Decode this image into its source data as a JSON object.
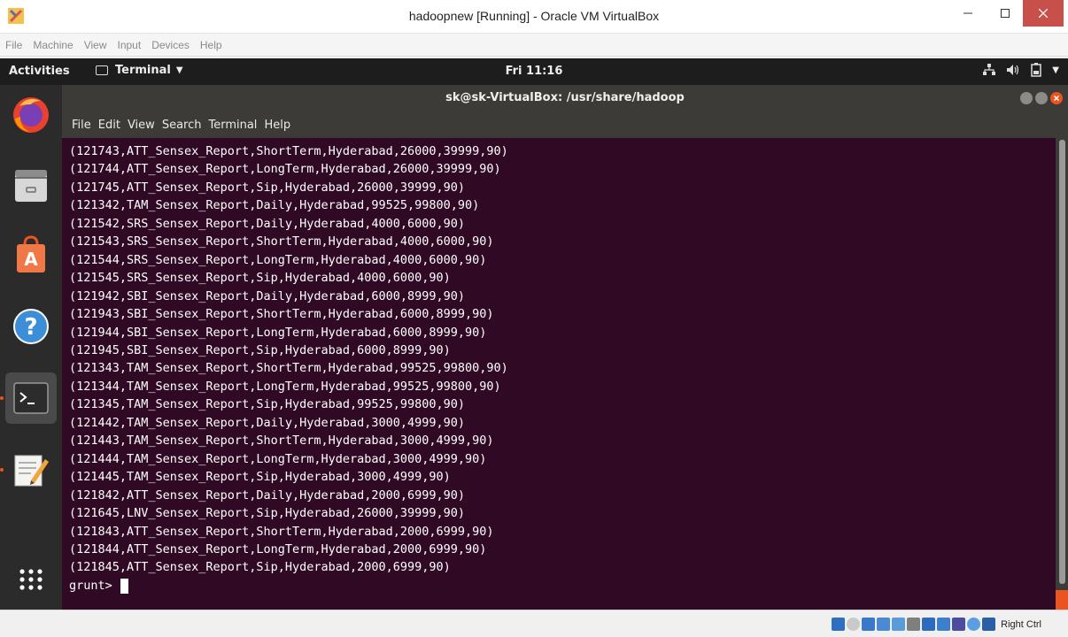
{
  "host_window": {
    "title": "hadoopnew [Running] - Oracle VM VirtualBox",
    "menu": [
      "File",
      "Machine",
      "View",
      "Input",
      "Devices",
      "Help"
    ]
  },
  "gnome_topbar": {
    "activities": "Activities",
    "app_menu": "Terminal",
    "clock": "Fri 11:16"
  },
  "terminal": {
    "title": "sk@sk-VirtualBox: /usr/share/hadoop",
    "menu": [
      "File",
      "Edit",
      "View",
      "Search",
      "Terminal",
      "Help"
    ],
    "lines": [
      "(121743,ATT_Sensex_Report,ShortTerm,Hyderabad,26000,39999,90)",
      "(121744,ATT_Sensex_Report,LongTerm,Hyderabad,26000,39999,90)",
      "(121745,ATT_Sensex_Report,Sip,Hyderabad,26000,39999,90)",
      "(121342,TAM_Sensex_Report,Daily,Hyderabad,99525,99800,90)",
      "(121542,SRS_Sensex_Report,Daily,Hyderabad,4000,6000,90)",
      "(121543,SRS_Sensex_Report,ShortTerm,Hyderabad,4000,6000,90)",
      "(121544,SRS_Sensex_Report,LongTerm,Hyderabad,4000,6000,90)",
      "(121545,SRS_Sensex_Report,Sip,Hyderabad,4000,6000,90)",
      "(121942,SBI_Sensex_Report,Daily,Hyderabad,6000,8999,90)",
      "(121943,SBI_Sensex_Report,ShortTerm,Hyderabad,6000,8999,90)",
      "(121944,SBI_Sensex_Report,LongTerm,Hyderabad,6000,8999,90)",
      "(121945,SBI_Sensex_Report,Sip,Hyderabad,6000,8999,90)",
      "(121343,TAM_Sensex_Report,ShortTerm,Hyderabad,99525,99800,90)",
      "(121344,TAM_Sensex_Report,LongTerm,Hyderabad,99525,99800,90)",
      "(121345,TAM_Sensex_Report,Sip,Hyderabad,99525,99800,90)",
      "(121442,TAM_Sensex_Report,Daily,Hyderabad,3000,4999,90)",
      "(121443,TAM_Sensex_Report,ShortTerm,Hyderabad,3000,4999,90)",
      "(121444,TAM_Sensex_Report,LongTerm,Hyderabad,3000,4999,90)",
      "(121445,TAM_Sensex_Report,Sip,Hyderabad,3000,4999,90)",
      "(121842,ATT_Sensex_Report,Daily,Hyderabad,2000,6999,90)",
      "(121645,LNV_Sensex_Report,Sip,Hyderabad,26000,39999,90)",
      "(121843,ATT_Sensex_Report,ShortTerm,Hyderabad,2000,6999,90)",
      "(121844,ATT_Sensex_Report,LongTerm,Hyderabad,2000,6999,90)",
      "(121845,ATT_Sensex_Report,Sip,Hyderabad,2000,6999,90)"
    ],
    "prompt": "grunt>"
  },
  "statusbar": {
    "host_key": "Right Ctrl"
  },
  "dock": {
    "items": [
      "firefox-icon",
      "files-icon",
      "software-icon",
      "help-icon",
      "terminal-icon",
      "text-editor-icon",
      "show-apps-icon"
    ]
  },
  "colors": {
    "terminal_bg": "#300a24",
    "accent": "#e95420",
    "window_close": "#c7504b"
  }
}
